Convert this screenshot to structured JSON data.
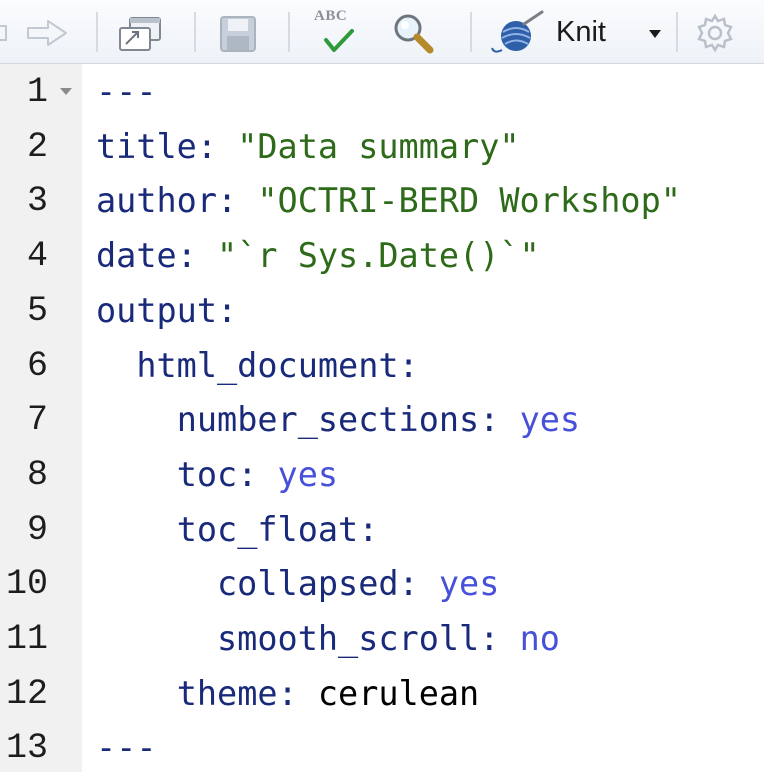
{
  "toolbar": {
    "knit_label": "Knit",
    "spellcheck_label": "ABC",
    "icons": [
      "forward-arrow-icon",
      "popout-icon",
      "save-icon",
      "spellcheck-icon",
      "search-icon",
      "knit-icon",
      "dropdown-arrow-icon",
      "gear-icon"
    ]
  },
  "editor": {
    "fold_line": 1,
    "lines": [
      {
        "num": "1",
        "indent": "",
        "key": "",
        "sep": "",
        "value": "",
        "value_type": "",
        "marker": "---"
      },
      {
        "num": "2",
        "indent": "",
        "key": "title",
        "sep": ": ",
        "value": "\"Data summary\"",
        "value_type": "string",
        "marker": ""
      },
      {
        "num": "3",
        "indent": "",
        "key": "author",
        "sep": ": ",
        "value": "\"OCTRI-BERD Workshop\"",
        "value_type": "string",
        "marker": ""
      },
      {
        "num": "4",
        "indent": "",
        "key": "date",
        "sep": ": ",
        "value": "\"`r Sys.Date()`\"",
        "value_type": "string",
        "marker": ""
      },
      {
        "num": "5",
        "indent": "",
        "key": "output",
        "sep": ":",
        "value": "",
        "value_type": "",
        "marker": ""
      },
      {
        "num": "6",
        "indent": "  ",
        "key": "html_document",
        "sep": ":",
        "value": "",
        "value_type": "",
        "marker": ""
      },
      {
        "num": "7",
        "indent": "    ",
        "key": "number_sections",
        "sep": ": ",
        "value": "yes",
        "value_type": "bool",
        "marker": ""
      },
      {
        "num": "8",
        "indent": "    ",
        "key": "toc",
        "sep": ": ",
        "value": "yes",
        "value_type": "bool",
        "marker": ""
      },
      {
        "num": "9",
        "indent": "    ",
        "key": "toc_float",
        "sep": ":",
        "value": "",
        "value_type": "",
        "marker": ""
      },
      {
        "num": "10",
        "indent": "      ",
        "key": "collapsed",
        "sep": ": ",
        "value": "yes",
        "value_type": "bool",
        "marker": ""
      },
      {
        "num": "11",
        "indent": "      ",
        "key": "smooth_scroll",
        "sep": ": ",
        "value": "no",
        "value_type": "bool",
        "marker": ""
      },
      {
        "num": "12",
        "indent": "    ",
        "key": "theme",
        "sep": ": ",
        "value": "cerulean",
        "value_type": "plain",
        "marker": ""
      },
      {
        "num": "13",
        "indent": "",
        "key": "",
        "sep": "",
        "value": "",
        "value_type": "",
        "marker": "---"
      }
    ]
  }
}
